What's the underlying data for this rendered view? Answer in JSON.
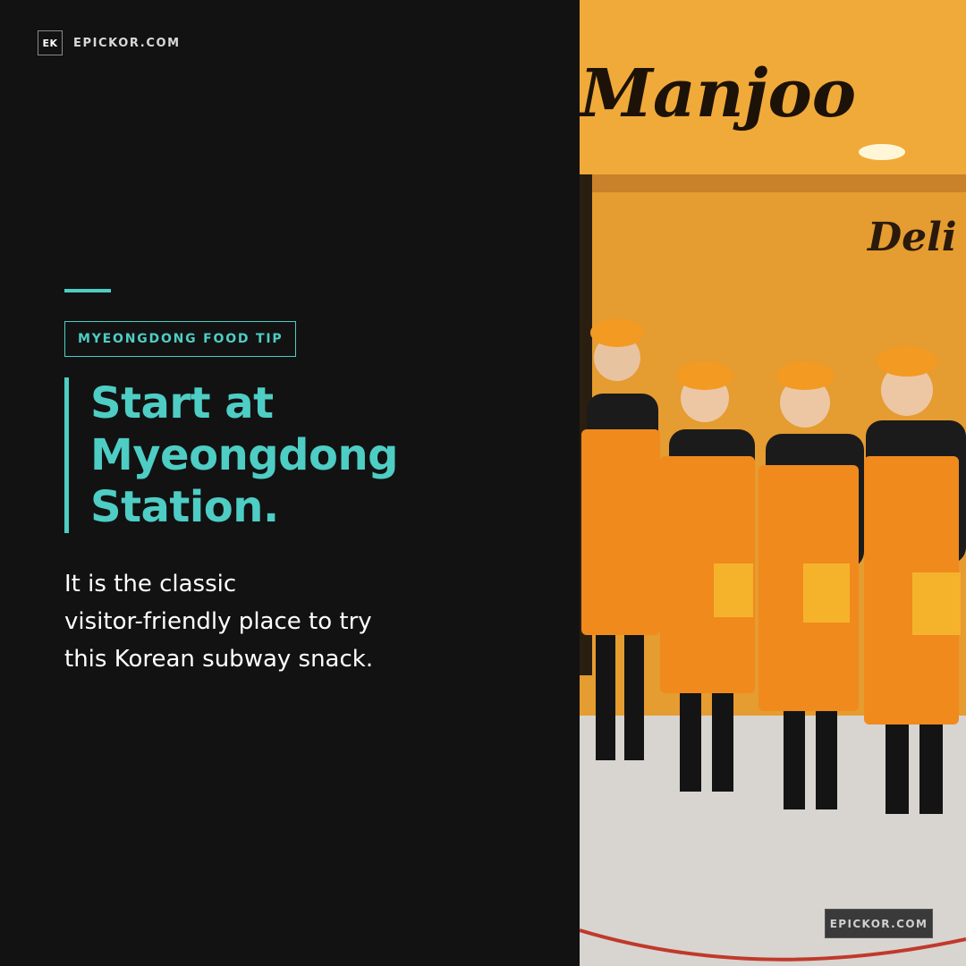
{
  "brand": {
    "mark": "EK",
    "site": "EPICKOR.COM"
  },
  "tag": "MYEONGDONG FOOD TIP",
  "headline": {
    "lines": [
      "Start at",
      "Myeongdong",
      "Station."
    ]
  },
  "body": {
    "lines": [
      "It is the classic",
      "visitor-friendly place to try",
      "this Korean subway snack."
    ]
  },
  "photo": {
    "sign_text": "Manjoo",
    "sub_sign_text": "Deli"
  },
  "watermark": "EPICKOR.COM",
  "colors": {
    "accent": "#4ecdc4",
    "background": "#121212",
    "apron": "#f08a1c",
    "wall": "#e8a030"
  }
}
